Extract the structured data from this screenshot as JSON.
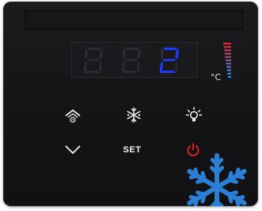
{
  "display": {
    "digits": [
      "8",
      "8",
      "2"
    ],
    "lit_digit_index": 2,
    "lit_color": "#1f3dff",
    "unlit_color": "#2c2c30",
    "unit": "°C"
  },
  "temperature_bar": {
    "warm_color": "#e3262b",
    "cold_color": "#2d8cf0"
  },
  "keys": {
    "defrost": {
      "icon": "defrost-up-icon"
    },
    "freeze": {
      "icon": "snowflake-icon"
    },
    "light": {
      "icon": "light-bulb-icon"
    },
    "down": {
      "icon": "chevron-down-icon"
    },
    "set": {
      "label": "SET"
    },
    "power": {
      "icon": "power-icon",
      "color": "#e02020"
    }
  },
  "decoration": {
    "snowflake_color": "#2b7fd4"
  }
}
